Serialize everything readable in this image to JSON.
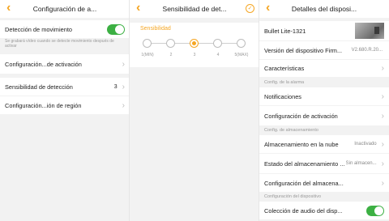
{
  "panel1": {
    "header": {
      "title": "Configuración de a..."
    },
    "motion_detection": {
      "label": "Detección de movimiento",
      "enabled": true,
      "note": "Se grabará vídeo cuando se detecte movimiento después de activar"
    },
    "activation_settings": {
      "label": "Configuración...de activación"
    },
    "sensitivity": {
      "label": "Sensibilidad de detección",
      "value": "3"
    },
    "region_settings": {
      "label": "Configuración...ión de región"
    }
  },
  "panel2": {
    "header": {
      "title": "Sensibilidad de det..."
    },
    "section_title": "Sensibilidad",
    "levels": [
      "1(MIN)",
      "2",
      "3",
      "4",
      "5(MAX)"
    ],
    "selected_level": 3
  },
  "panel3": {
    "header": {
      "title": "Detalles del disposi..."
    },
    "device_name": "Bullet Lite-1321",
    "firmware": {
      "label": "Versión del dispositivo Firm...",
      "value": "V2.680.R.20..."
    },
    "features": {
      "label": "Características"
    },
    "section_alarm": "Config. de la alarma",
    "notifications": {
      "label": "Notificaciones"
    },
    "activation_config": {
      "label": "Configuración de activación"
    },
    "section_storage": "Config. de almacenamiento",
    "cloud_storage": {
      "label": "Almacenamiento en la nube",
      "value": "Inactivado"
    },
    "storage_state": {
      "label": "Estado del almacenamiento ...",
      "value": "Sin almacen..."
    },
    "storage_config": {
      "label": "Configuración del almacena..."
    },
    "section_device": "Configuración del dispositivo",
    "audio_collection": {
      "label": "Colección de audio del disp...",
      "enabled": true
    }
  },
  "colors": {
    "accent": "#f5a623",
    "toggle_on": "#3cb043",
    "background": "#f2f2f2"
  }
}
